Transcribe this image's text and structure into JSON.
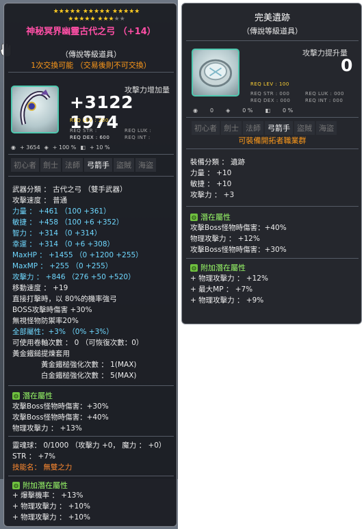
{
  "left": {
    "stars_row1": "★★★★★ ★★★★★ ★★★★★",
    "stars_row2_gold": "★★★★★ ★★★",
    "stars_row2_grey": "★★",
    "item_name": "神秘冥界幽靈古代之弓 （+14）",
    "grade": "（傳說等級道具）",
    "trade": "1次交換可能 （交易後則不可交換）",
    "atk_increase_label": "攻擊力增加量",
    "atk_increase_value": "+3122 1974",
    "req_lev": "REQ LEV :  200",
    "req_str": "REQ STR :",
    "req_luk": "REQ LUK :",
    "req_dex": "REQ DEX :  600",
    "req_int": "REQ INT :",
    "icon_stats": [
      "◉",
      "+ 3654",
      "◈",
      "+ 100 %",
      "◧",
      "+ 10 %"
    ],
    "jobs": [
      "初心者",
      "劍士",
      "法師",
      "弓箭手",
      "盜賊",
      "海盜"
    ],
    "lines": [
      {
        "t": "武器分類 ： 古代之弓 （雙手武器）",
        "c": "white"
      },
      {
        "t": "攻擊速度 ： 普通",
        "c": "white"
      },
      {
        "t": "力量 ： +461 （100 +361）",
        "c": "cyan"
      },
      {
        "t": "敏捷 ： +458 （100 +6 +352）",
        "c": "cyan"
      },
      {
        "t": "智力 ： +314 （0 +314）",
        "c": "cyan"
      },
      {
        "t": "幸運 ： +314 （0 +6 +308）",
        "c": "cyan"
      },
      {
        "t": "MaxHP ： +1455 （0 +1200 +255）",
        "c": "cyan"
      },
      {
        "t": "MaxMP ： +255 （0 +255）",
        "c": "cyan"
      },
      {
        "t": "攻擊力 ： +846 （276 +50 +520）",
        "c": "cyan"
      },
      {
        "t": "移動速度 ： +19",
        "c": "white"
      },
      {
        "t": "直接打擊時，以 80%的機率強弓",
        "c": "white"
      },
      {
        "t": "BOSS攻擊時傷害 +30%",
        "c": "white"
      },
      {
        "t": "無視怪物防禦率20%",
        "c": "white"
      },
      {
        "t": "全部屬性：+3% （0% +3%）",
        "c": "cyan"
      },
      {
        "t": "可使用卷軸次數 ： 0 （可恢復次數：0）",
        "c": "white"
      },
      {
        "t": "黃金鐵鎚提煉套用",
        "c": "white"
      },
      {
        "t": "黃金鐵槌強化次數 ： 1(MAX)",
        "c": "white",
        "indent": true
      },
      {
        "t": "白金鐵槌強化次數 ： 5(MAX)",
        "c": "white",
        "indent": true
      }
    ],
    "potential_title": "潛在屬性",
    "potential": [
      "攻擊Boss怪物時傷害：+30%",
      "攻擊Boss怪物時傷害：+40%",
      "物理攻擊力 ： +13%"
    ],
    "soul": "靈魂球： 0/1000 （攻擊力 +0， 魔力 ： +0）",
    "soul_str": "STR ： +7%",
    "skill": "技能名： 無雙之力",
    "addpot_title": "附加潛在屬性",
    "addpot": [
      "+ 爆擊機率 ： +13%",
      "+ 物理攻擊力 ： +10%",
      "+ 物理攻擊力 ： +10%"
    ]
  },
  "right": {
    "title": "完美遺跡",
    "grade": "（傳說等級道具）",
    "atk_label": "攻擊力提升量",
    "atk_value": "0",
    "req_lev": "REQ LEV :   100",
    "req_str": "REQ STR :  000",
    "req_luk": "REQ LUK :  000",
    "req_dex": "REQ DEX :  000",
    "req_int": "REQ INT :  000",
    "icon_stats": [
      "◉",
      "0",
      "◈",
      "0 %",
      "◧",
      "0 %"
    ],
    "jobs": [
      "初心者",
      "劍士",
      "法師",
      "弓箭手",
      "盜賊",
      "海盜"
    ],
    "jobs_note": "可裝備開拓者職業群",
    "lines": [
      "裝備分類 ： 遺跡",
      "力量 ： +10",
      "敏捷 ： +10",
      "攻擊力 ： +3"
    ],
    "potential_title": "潛在屬性",
    "potential": [
      "攻擊Boss怪物時傷害：+40%",
      "物理攻擊力 ： +12%",
      "攻擊Boss怪物時傷害：+30%"
    ],
    "addpot_title": "附加潛在屬性",
    "addpot": [
      "+ 物理攻擊力 ： +12%",
      "+ 最大MP ： +7%",
      "+ 物理攻擊力 ： +9%"
    ]
  },
  "colors": {
    "accent": "#4fc9b0",
    "potential": "#6fc03f",
    "name": "#ff4fa6",
    "stat": "#6fd8ff",
    "trade": "#ff9a1a"
  }
}
